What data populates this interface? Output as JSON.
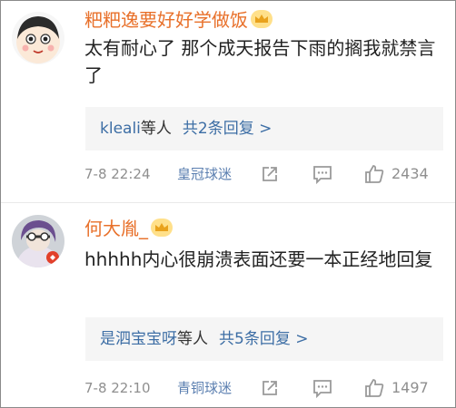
{
  "comments": [
    {
      "user": "粑粑逸要好好学做饭",
      "text": "太有耐心了 那个成天报告下雨的搁我就禁言了",
      "reply_users": "kleali",
      "reply_suffix": "等人",
      "reply_count": "共2条回复 >",
      "time": "7-8 22:24",
      "badge": "皇冠球迷",
      "likes": "2434"
    },
    {
      "user": "何大胤_",
      "text": "hhhhh内心很崩溃表面还要一本正经地回复",
      "reply_users": "是泗宝宝呀",
      "reply_suffix": "等人",
      "reply_count": "共5条回复 >",
      "time": "7-8 22:10",
      "badge": "青铜球迷",
      "likes": "1497"
    }
  ],
  "icons": [
    "crown-icon",
    "share-icon",
    "comment-icon",
    "like-icon"
  ],
  "colors": {
    "username": "#e8702a",
    "link": "#3d6ea5",
    "meta": "#8f8f8f",
    "reply_bg": "#f5f5f5",
    "crown": "#e9a21c"
  }
}
